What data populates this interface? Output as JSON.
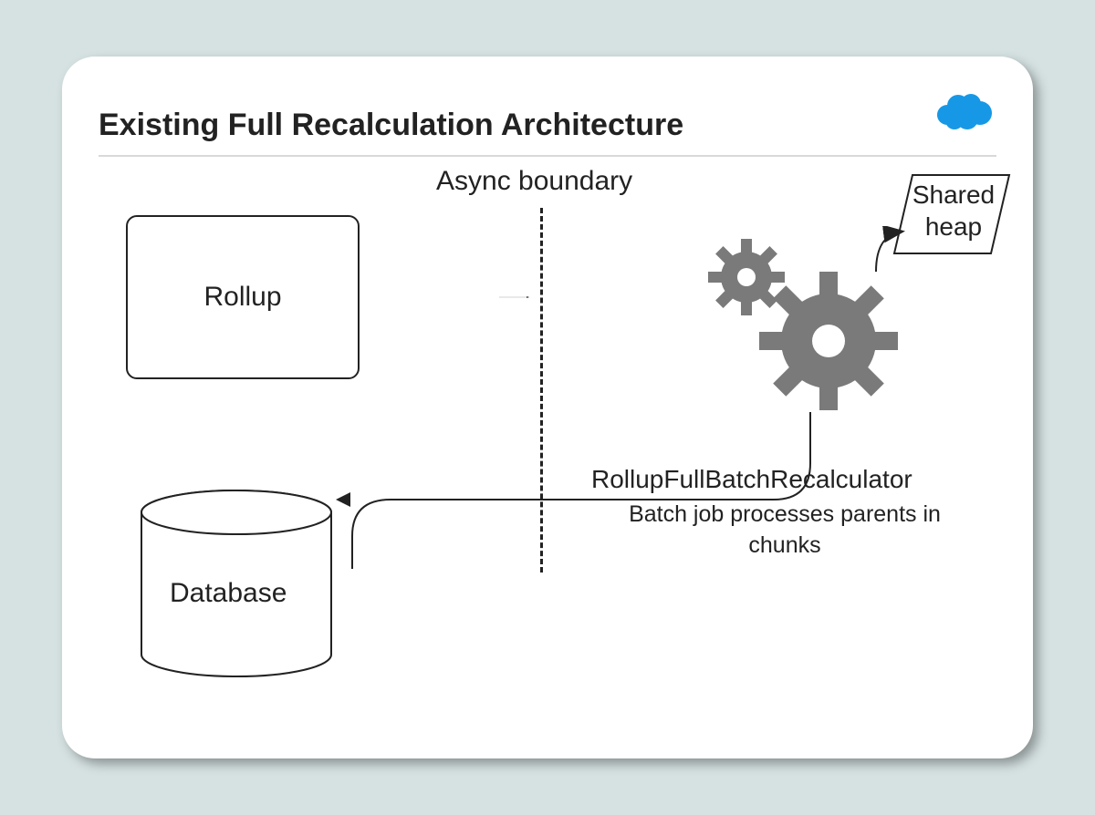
{
  "title": "Existing Full Recalculation Architecture",
  "async_boundary_label": "Async boundary",
  "rollup_box_label": "Rollup",
  "shared_heap_line1": "Shared",
  "shared_heap_line2": "heap",
  "recalc_title": "RollupFullBatchRecalculator",
  "recalc_sub": "Batch job processes parents in chunks",
  "database_label": "Database",
  "colors": {
    "logo": "#1798e6",
    "gear": "#7a7a7a",
    "stroke": "#222222"
  }
}
